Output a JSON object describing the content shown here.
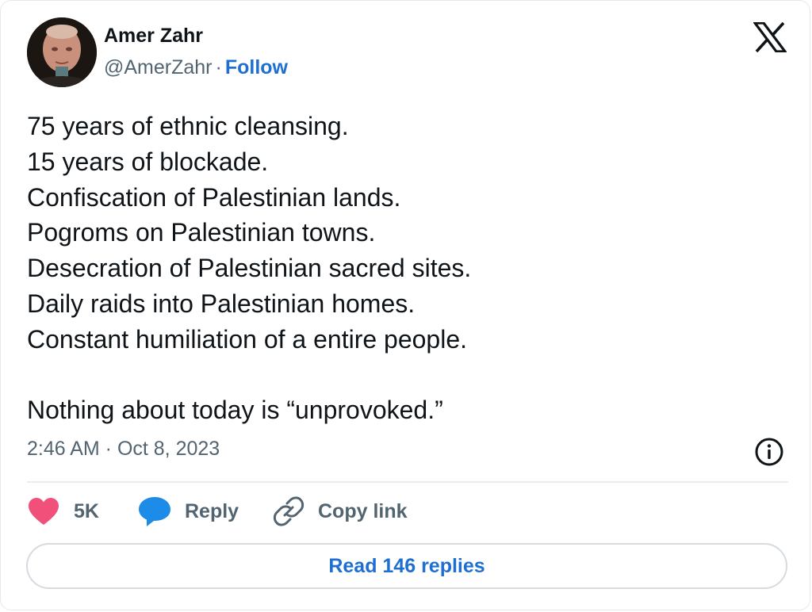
{
  "author": {
    "name": "Amer Zahr",
    "handle": "@AmerZahr",
    "separator": "·",
    "follow_label": "Follow"
  },
  "tweet": {
    "lines": [
      "75 years of ethnic cleansing.",
      "15 years of blockade.",
      "Confiscation of Palestinian lands.",
      "Pogroms on Palestinian towns.",
      "Desecration of Palestinian sacred sites.",
      "Daily raids into Palestinian homes.",
      "Constant humiliation of a entire people.",
      "",
      "Nothing about today is “unprovoked.”"
    ],
    "timestamp": "2:46 AM · Oct 8, 2023"
  },
  "actions": {
    "like_count": "5K",
    "reply_label": "Reply",
    "copy_link_label": "Copy link",
    "read_replies_label": "Read 146 replies"
  },
  "icons": {
    "platform": "x-logo-icon",
    "info": "info-icon",
    "like": "heart-icon",
    "reply": "speech-bubble-icon",
    "copy_link": "link-icon"
  },
  "colors": {
    "text": "#0f1419",
    "secondary": "#536471",
    "link_blue": "#1d6fd1",
    "heart": "#f0507a",
    "reply_bubble": "#1d8be8"
  }
}
